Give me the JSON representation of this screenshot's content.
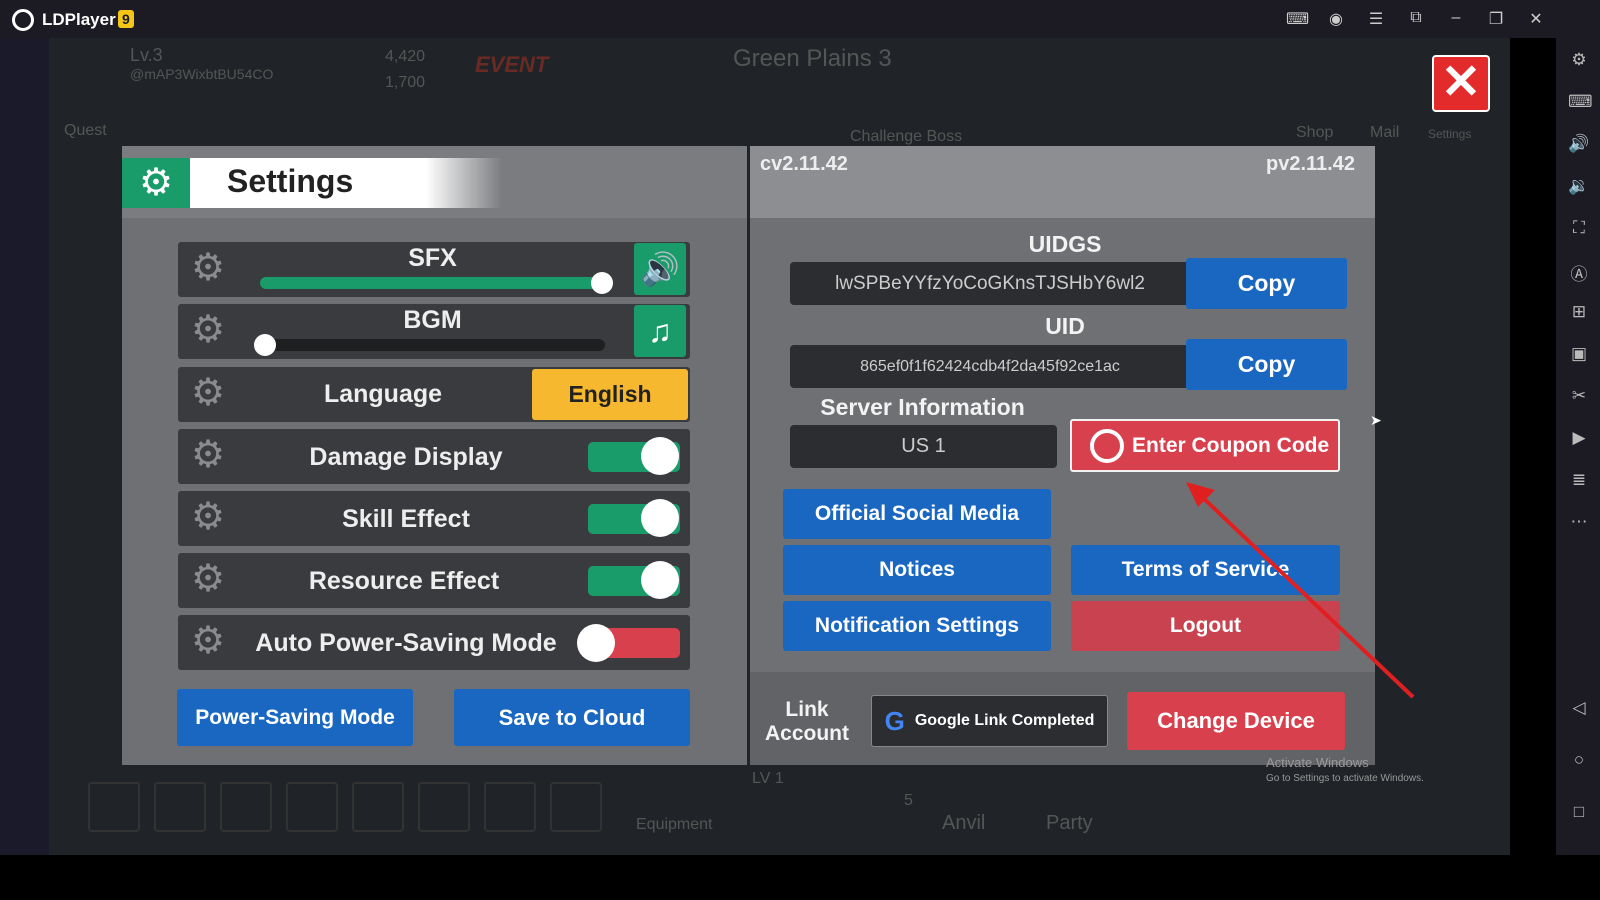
{
  "app": {
    "name": "LDPlayer",
    "version_badge": "9"
  },
  "background": {
    "level": "Lv.3",
    "player_id": "@mAP3WixbtBU54CO",
    "gold": "4,420",
    "gems": "1,700",
    "event": "EVENT",
    "stage": "Green Plains 3",
    "challenge": "Challenge Boss",
    "quest": "Quest",
    "shop": "Shop",
    "mail": "Mail",
    "settings": "Settings",
    "equipment": "Equipment",
    "anvil": "Anvil",
    "party": "Party",
    "level_badge": "LV 1",
    "five": "5"
  },
  "settings": {
    "title": "Settings",
    "sfx": {
      "label": "SFX",
      "level": 1.0
    },
    "bgm": {
      "label": "BGM",
      "level": 0.0
    },
    "language": {
      "label": "Language",
      "value": "English"
    },
    "damage_display": {
      "label": "Damage Display",
      "on": true
    },
    "skill_effect": {
      "label": "Skill Effect",
      "on": true
    },
    "resource_effect": {
      "label": "Resource Effect",
      "on": true
    },
    "auto_power_saving": {
      "label": "Auto Power-Saving Mode",
      "on": false
    },
    "power_saving_button": "Power-Saving Mode",
    "save_cloud_button": "Save to Cloud"
  },
  "account": {
    "client_version": "cv2.11.42",
    "patch_version": "pv2.11.42",
    "uidgs_label": "UIDGS",
    "uidgs": "lwSPBeYYfzYoCoGKnsTJSHbY6wl2",
    "uid_label": "UID",
    "uid": "865ef0f1f62424cdb4f2da45f92ce1ac",
    "copy": "Copy",
    "server_label": "Server Information",
    "server": "US 1",
    "coupon": "Enter Coupon Code",
    "social": "Official Social Media",
    "notices": "Notices",
    "terms": "Terms of Service",
    "notification": "Notification Settings",
    "logout": "Logout",
    "link_account": "Link Account",
    "google": "Google Link Completed",
    "change_device": "Change Device"
  },
  "windows": {
    "line1": "Activate Windows",
    "line2": "Go to Settings to activate Windows."
  },
  "colors": {
    "green": "#1a9c6a",
    "blue": "#1a67c2",
    "red": "#c8434f",
    "yellow": "#f5b82e",
    "close": "#e32b2b"
  }
}
